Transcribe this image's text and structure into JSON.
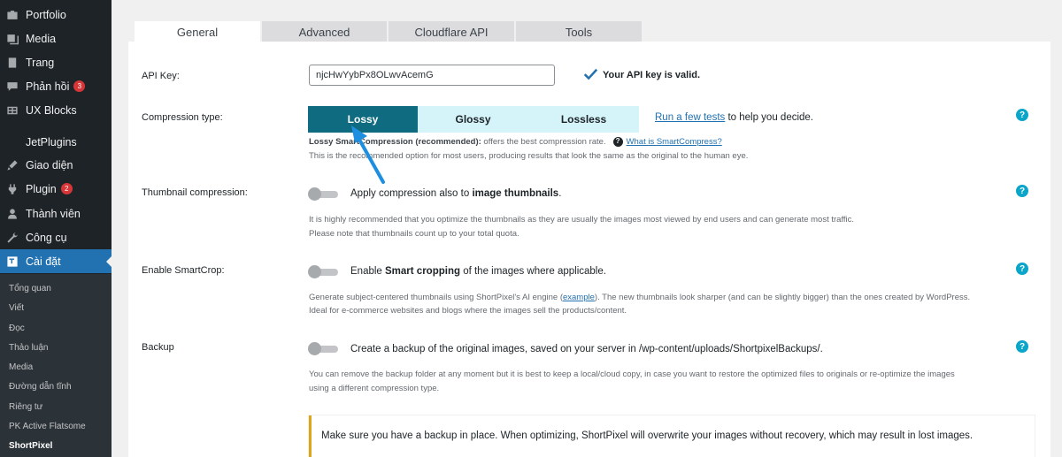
{
  "sidebar": {
    "items": [
      {
        "label": "Portfolio",
        "icon": "portfolio-icon"
      },
      {
        "label": "Media",
        "icon": "media-icon"
      },
      {
        "label": "Trang",
        "icon": "pages-icon"
      },
      {
        "label": "Phản hồi",
        "icon": "comments-icon",
        "badge": "3"
      },
      {
        "label": "UX Blocks",
        "icon": "ux-blocks-icon"
      },
      {
        "label": "JetPlugins",
        "icon": ""
      },
      {
        "label": "Giao diện",
        "icon": "appearance-icon"
      },
      {
        "label": "Plugin",
        "icon": "plugins-icon",
        "badge": "2"
      },
      {
        "label": "Thành viên",
        "icon": "users-icon"
      },
      {
        "label": "Công cụ",
        "icon": "tools-icon"
      },
      {
        "label": "Cài đặt",
        "icon": "settings-icon",
        "active": true
      }
    ],
    "submenu": [
      "Tổng quan",
      "Viết",
      "Đọc",
      "Thảo luận",
      "Media",
      "Đường dẫn tĩnh",
      "Riêng tư",
      "PK Active Flatsome",
      "ShortPixel"
    ],
    "submenu_current": "ShortPixel",
    "colors": {
      "active": "#2271b1",
      "background": "#1d2327",
      "badge": "#d63638"
    }
  },
  "tabs": [
    "General",
    "Advanced",
    "Cloudflare API",
    "Tools"
  ],
  "active_tab": "General",
  "api_key": {
    "label": "API Key:",
    "value": "njcHwYybPx8OLwvAcemG",
    "status": "Your API key is valid."
  },
  "compression": {
    "label": "Compression type:",
    "options": [
      "Lossy",
      "Glossy",
      "Lossless"
    ],
    "selected": "Lossy",
    "run_tests_link": "Run a few tests",
    "run_tests_suffix": " to help you decide.",
    "desc_bold": "Lossy SmartCompression (recommended):",
    "desc_text": " offers the best compression rate.",
    "what_is_link": "What is SmartCompress?",
    "desc_line2": "This is the recommended option for most users, producing results that look the same as the original to the human eye.",
    "colors": {
      "selected": "#0f6b80",
      "unselected": "#d4f4fa"
    }
  },
  "thumbnail": {
    "label": "Thumbnail compression:",
    "toggle_prefix": "Apply compression also to ",
    "toggle_bold": "image thumbnails",
    "toggle_suffix": ".",
    "enabled": false,
    "desc_line1": "It is highly recommended that you optimize the thumbnails as they are usually the images most viewed by end users and can generate most traffic.",
    "desc_line2": "Please note that thumbnails count up to your total quota."
  },
  "smartcrop": {
    "label": "Enable SmartCrop:",
    "toggle_prefix": "Enable ",
    "toggle_bold": "Smart cropping",
    "toggle_suffix": " of the images where applicable.",
    "enabled": false,
    "desc_part1": "Generate subject-centered thumbnails using ShortPixel's AI engine (",
    "desc_link": "example",
    "desc_part2": "). The new thumbnails look sharper (and can be slightly bigger) than the ones created by WordPress.",
    "desc_line2": "Ideal for e-commerce websites and blogs where the images sell the products/content."
  },
  "backup": {
    "label": "Backup",
    "toggle_text": "Create a backup of the original images, saved on your server in /wp-content/uploads/ShortpixelBackups/.",
    "enabled": false,
    "desc_line1": "You can remove the backup folder at any moment but it is best to keep a local/cloud copy, in case you want to restore the optimized files to originals or re-optimize the images",
    "desc_line2": "using a different compression type.",
    "notice": "Make sure you have a backup in place. When optimizing, ShortPixel will overwrite your images without recovery, which may result in lost images.",
    "notice_color": "#dba617"
  },
  "help_icon_glyph": "?",
  "accent_color": "#0aa5c9"
}
